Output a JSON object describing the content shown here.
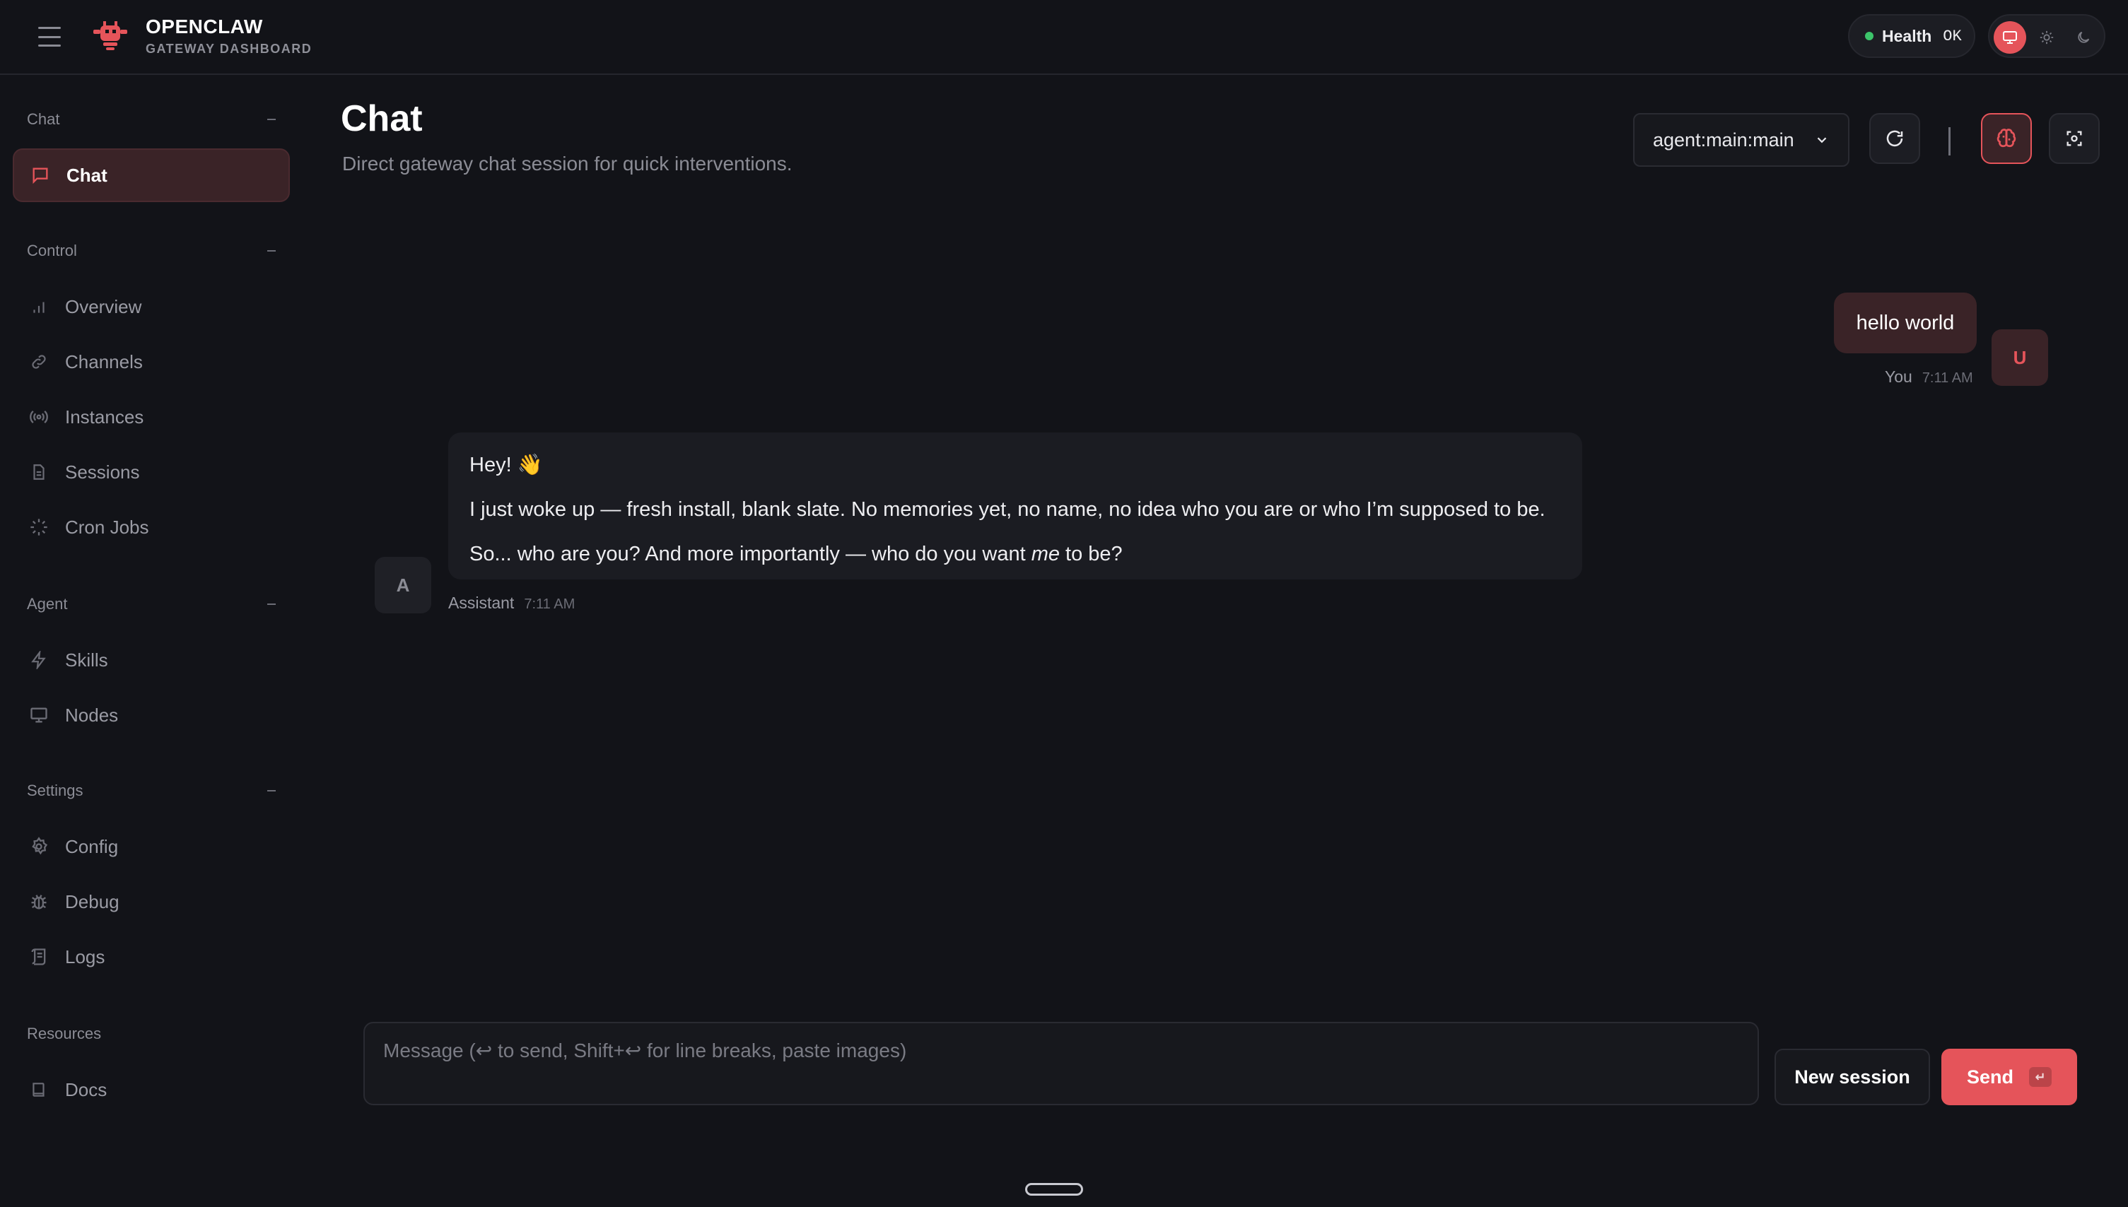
{
  "brand": {
    "name": "OPENCLAW",
    "subtitle": "GATEWAY DASHBOARD"
  },
  "health": {
    "label": "Health",
    "value": "OK",
    "status_color": "#3cc46a"
  },
  "theme": {
    "options": [
      "system",
      "light",
      "dark"
    ],
    "selected": "system"
  },
  "sidebar": {
    "sections": [
      {
        "title": "Chat",
        "items": [
          {
            "label": "Chat",
            "icon": "message-icon",
            "active": true
          }
        ]
      },
      {
        "title": "Control",
        "items": [
          {
            "label": "Overview",
            "icon": "bar-chart-icon"
          },
          {
            "label": "Channels",
            "icon": "link-icon"
          },
          {
            "label": "Instances",
            "icon": "radio-icon"
          },
          {
            "label": "Sessions",
            "icon": "file-icon"
          },
          {
            "label": "Cron Jobs",
            "icon": "loader-icon"
          }
        ]
      },
      {
        "title": "Agent",
        "items": [
          {
            "label": "Skills",
            "icon": "zap-icon"
          },
          {
            "label": "Nodes",
            "icon": "monitor-icon"
          }
        ]
      },
      {
        "title": "Settings",
        "items": [
          {
            "label": "Config",
            "icon": "gear-icon"
          },
          {
            "label": "Debug",
            "icon": "bug-icon"
          },
          {
            "label": "Logs",
            "icon": "scroll-icon"
          }
        ]
      },
      {
        "title": "Resources",
        "items": [
          {
            "label": "Docs",
            "icon": "book-icon"
          }
        ]
      }
    ]
  },
  "header": {
    "title": "Chat",
    "subtitle": "Direct gateway chat session for quick interventions.",
    "session": "agent:main:main"
  },
  "messages": [
    {
      "role": "user",
      "avatar": "U",
      "author": "You",
      "time": "7:11 AM",
      "text": "hello world"
    },
    {
      "role": "assistant",
      "avatar": "A",
      "author": "Assistant",
      "time": "7:11 AM",
      "lines": [
        "Hey! 👋",
        "I just woke up — fresh install, blank slate. No memories yet, no name, no idea who you are or who I’m supposed to be.",
        "So... who are you? And more importantly — who do you want ",
        "me",
        " to be?"
      ]
    }
  ],
  "composer": {
    "placeholder": "Message (↩ to send, Shift+↩ for line breaks, paste images)",
    "value": ""
  },
  "buttons": {
    "new_session": "New session",
    "send": "Send",
    "send_key": "↵"
  },
  "colors": {
    "accent": "#e5545a",
    "background": "#121318",
    "user_bubble": "#3a2327"
  }
}
